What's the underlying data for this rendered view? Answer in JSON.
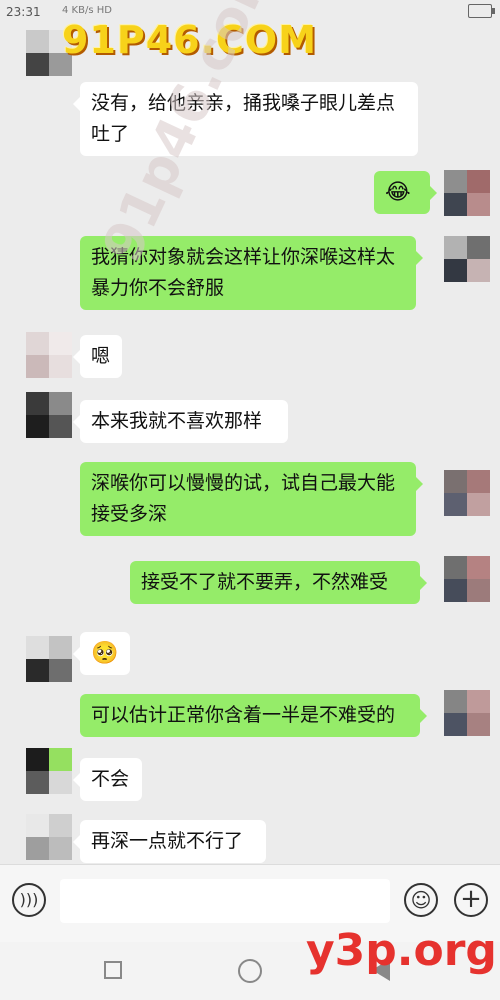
{
  "status_bar": {
    "time": "23:31",
    "network": "4 KB/s HD"
  },
  "messages": [
    {
      "side": "in",
      "text": "没有，给他亲亲，捅我嗓子眼儿差点吐了"
    },
    {
      "side": "out",
      "text": "😂"
    },
    {
      "side": "out",
      "text": "我猜你对象就会这样让你深喉这样太暴力你不会舒服"
    },
    {
      "side": "in",
      "text": "嗯"
    },
    {
      "side": "in",
      "text": "本来我就不喜欢那样"
    },
    {
      "side": "out",
      "text": "深喉你可以慢慢的试，试自己最大能接受多深"
    },
    {
      "side": "out",
      "text": "接受不了就不要弄，不然难受"
    },
    {
      "side": "in",
      "text": "🥺"
    },
    {
      "side": "out",
      "text": "可以估计正常你含着一半是不难受的"
    },
    {
      "side": "in",
      "text": "不会"
    },
    {
      "side": "in",
      "text": "再深一点就不行了"
    }
  ],
  "input_bar": {
    "voice_icon": "voice-icon",
    "input_value": "",
    "emoji_icon": "emoji-icon",
    "plus_icon": "plus-icon"
  },
  "watermarks": {
    "top": "91P46.COM",
    "diagonal": "91p46.com",
    "bottom": "y3p.org"
  },
  "colors": {
    "outgoing_bubble": "#95ec69",
    "incoming_bubble": "#ffffff",
    "background": "#ececec"
  }
}
